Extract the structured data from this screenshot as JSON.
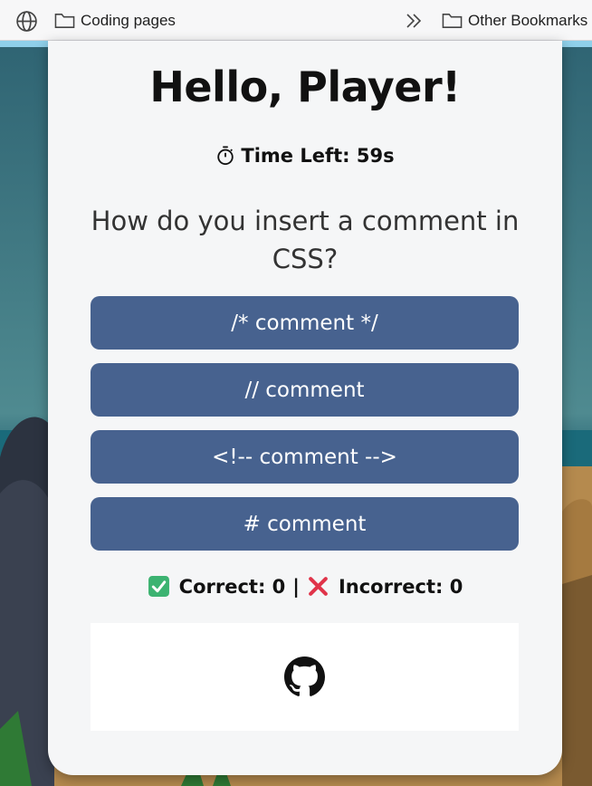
{
  "bookmarks": {
    "items": [
      {
        "label": "Coding pages",
        "icon": "folder-icon"
      },
      {
        "label": "Other Bookmarks",
        "icon": "folder-icon"
      }
    ]
  },
  "quiz": {
    "greeting": "Hello, Player!",
    "timer_label": "Time Left: 59s",
    "question": "How do you insert a comment in CSS?",
    "answers": [
      {
        "label": "/* comment */"
      },
      {
        "label": "// comment"
      },
      {
        "label": "<!-- comment -->"
      },
      {
        "label": "# comment"
      }
    ],
    "score": {
      "correct_label": "Correct: 0",
      "separator": "|",
      "incorrect_label": "Incorrect: 0"
    },
    "footer_icon": "github-icon"
  },
  "colors": {
    "card": "#f5f6f7",
    "answer_button": "#47628f",
    "accent_strip": "#8fd0ea",
    "check": "#3cb371",
    "cross": "#e0344a"
  }
}
